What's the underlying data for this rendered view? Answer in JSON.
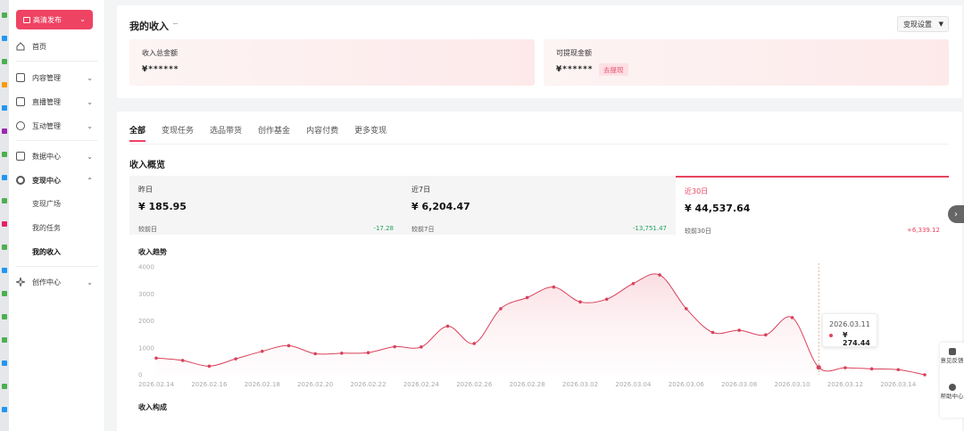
{
  "sidebar": {
    "publish_label": "高清发布",
    "items": [
      {
        "label": "首页"
      },
      {
        "label": "内容管理"
      },
      {
        "label": "直播管理"
      },
      {
        "label": "互动管理"
      },
      {
        "label": "数据中心"
      },
      {
        "label": "变现中心"
      },
      {
        "label": "创作中心"
      }
    ],
    "sub_items": [
      {
        "label": "变现广场"
      },
      {
        "label": "我的任务"
      },
      {
        "label": "我的收入"
      }
    ]
  },
  "header": {
    "title": "我的收入",
    "settings_label": "变现设置"
  },
  "balances": {
    "total_label": "收入总金额",
    "total_value": "¥******",
    "withdrawable_label": "可提现金额",
    "withdrawable_value": "¥******",
    "withdraw_button": "去提现"
  },
  "tabs": [
    {
      "label": "全部"
    },
    {
      "label": "变现任务"
    },
    {
      "label": "选品带货"
    },
    {
      "label": "创作基金"
    },
    {
      "label": "内容付费"
    },
    {
      "label": "更多变现"
    }
  ],
  "overview": {
    "title": "收入概览",
    "stats": [
      {
        "label": "昨日",
        "value": "¥ 185.95",
        "compare_label": "较前日",
        "delta": "-17.28"
      },
      {
        "label": "近7日",
        "value": "¥ 6,204.47",
        "compare_label": "较前7日",
        "delta": "-13,751.47"
      },
      {
        "label": "近30日",
        "value": "¥ 44,537.64",
        "compare_label": "较前30日",
        "delta": "+6,339.12"
      }
    ]
  },
  "trend": {
    "title": "收入趋势",
    "tooltip_date": "2026.03.11",
    "tooltip_value": "¥ 274.44"
  },
  "composition_title": "收入构成",
  "float_panel": {
    "feedback": "意见反馈",
    "help": "帮助中心"
  },
  "colors": {
    "accent": "#ef4363",
    "positive": "#e8435f",
    "negative": "#22a45d"
  },
  "chart_data": {
    "type": "area",
    "title": "收入趋势",
    "ylim": [
      0,
      4000
    ],
    "yticks": [
      0,
      1000,
      2000,
      3000,
      4000
    ],
    "xtick_labels": [
      "2026.02.14",
      "2026.02.16",
      "2026.02.18",
      "2026.02.20",
      "2026.02.22",
      "2026.02.24",
      "2026.02.26",
      "2026.02.28",
      "2026.03.02",
      "2026.03.04",
      "2026.03.06",
      "2026.03.08",
      "2026.03.10",
      "2026.03.12",
      "2026.03.14"
    ],
    "x": [
      "2026.02.14",
      "2026.02.15",
      "2026.02.16",
      "2026.02.17",
      "2026.02.18",
      "2026.02.19",
      "2026.02.20",
      "2026.02.21",
      "2026.02.22",
      "2026.02.23",
      "2026.02.24",
      "2026.02.25",
      "2026.02.26",
      "2026.02.27",
      "2026.02.28",
      "2026.03.01",
      "2026.03.02",
      "2026.03.03",
      "2026.03.04",
      "2026.03.05",
      "2026.03.06",
      "2026.03.07",
      "2026.03.08",
      "2026.03.09",
      "2026.03.10",
      "2026.03.11",
      "2026.03.12",
      "2026.03.13",
      "2026.03.14",
      "2026.03.15"
    ],
    "values": [
      620,
      530,
      320,
      590,
      870,
      1080,
      780,
      800,
      820,
      1040,
      1030,
      1800,
      1160,
      2450,
      2860,
      3250,
      2700,
      2800,
      3380,
      3700,
      2450,
      1570,
      1650,
      1480,
      2120,
      274,
      260,
      220,
      190,
      0
    ],
    "highlight_index": 25
  }
}
